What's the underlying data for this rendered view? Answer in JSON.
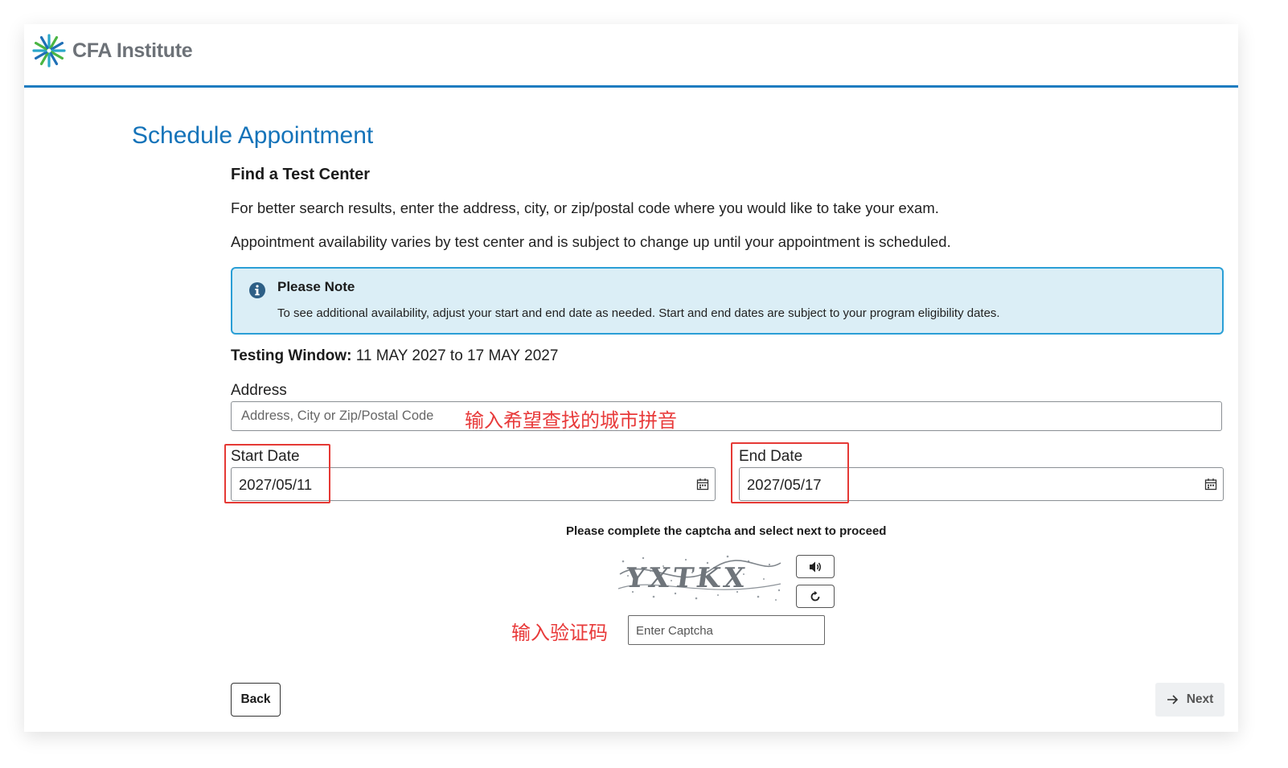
{
  "header": {
    "logo_text": "CFA Institute"
  },
  "page": {
    "title": "Schedule Appointment",
    "section_title": "Find a Test Center",
    "intro_1": "For better search results, enter the address, city, or zip/postal code where you would like to take your exam.",
    "intro_2": "Appointment availability varies by test center and is subject to change up until your appointment is scheduled."
  },
  "note": {
    "title": "Please Note",
    "body": "To see additional availability, adjust your start and end date as needed. Start and end dates are subject to your program eligibility dates."
  },
  "testing_window": {
    "label": "Testing Window:",
    "value": "11 MAY 2027 to 17 MAY 2027"
  },
  "address": {
    "label": "Address",
    "placeholder": "Address, City or Zip/Postal Code",
    "annotation": "输入希望查找的城市拼音"
  },
  "start_date": {
    "label": "Start Date",
    "value": "2027/05/11"
  },
  "end_date": {
    "label": "End Date",
    "value": "2027/05/17"
  },
  "captcha": {
    "instruction": "Please complete the captcha and select next to proceed",
    "image_text": "YXTKX",
    "audio_icon": "speaker-icon",
    "refresh_icon": "refresh-icon",
    "placeholder": "Enter Captcha",
    "annotation": "输入验证码"
  },
  "buttons": {
    "back": "Back",
    "next": "Next"
  },
  "colors": {
    "brand_blue": "#1473b9",
    "note_bg": "#dbeef6",
    "note_border": "#2a9fd6",
    "annotation_red": "#e53935"
  }
}
